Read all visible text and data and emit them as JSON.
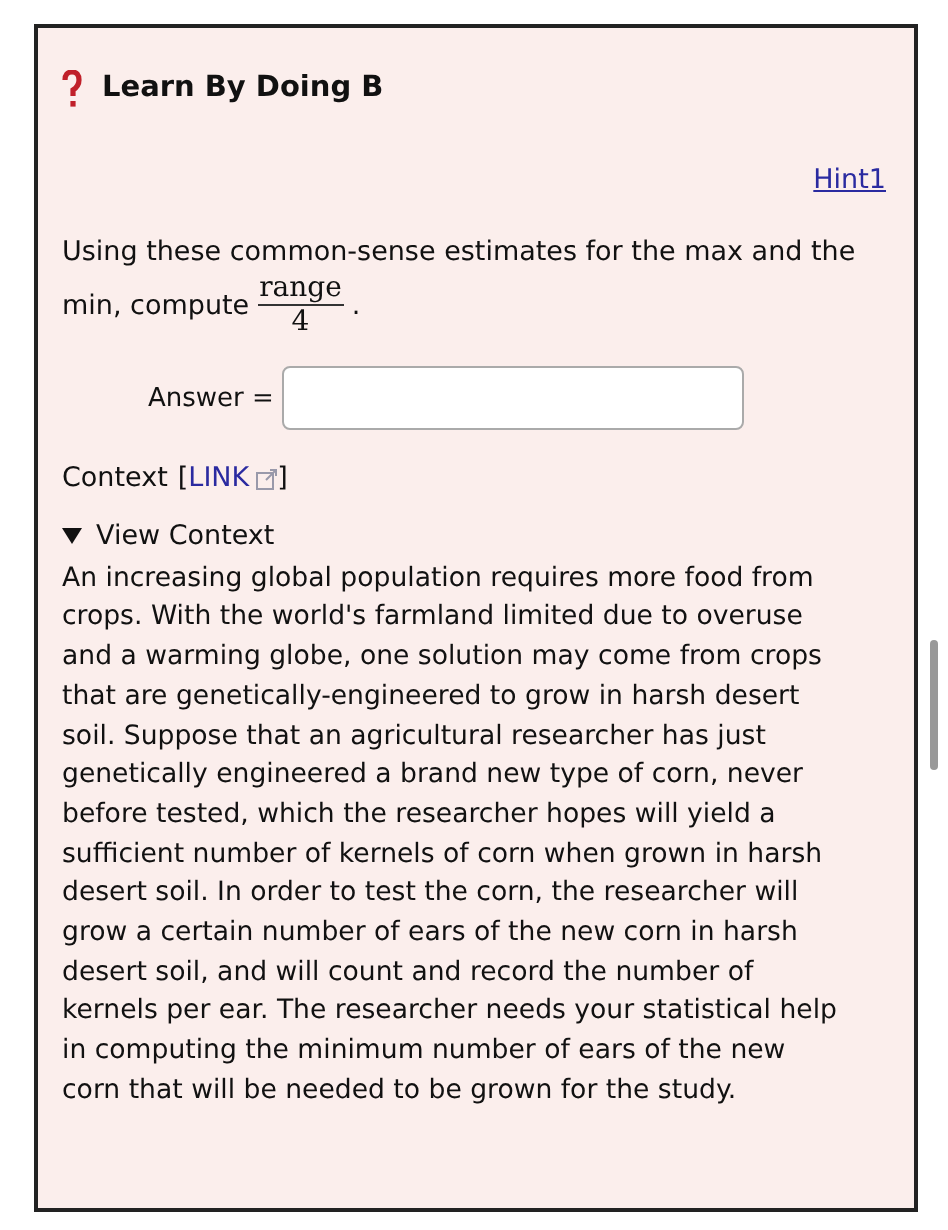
{
  "title": "Learn By Doing B",
  "hint_link": "Hint1",
  "question": {
    "line_1": "Using these common-sense estimates for the max and the",
    "before": "min, compute",
    "numerator": "range",
    "denominator": "4",
    "after": "."
  },
  "answer": {
    "label": "Answer ="
  },
  "context": {
    "label": "Context",
    "open_bracket": "[",
    "link": "LINK",
    "close_bracket": "]"
  },
  "view_context": {
    "label": "View Context",
    "expanded": true,
    "text": "An increasing global population requires more food from crops. With the world's farmland limited due to overuse and a warming globe, one solution may come from crops that are genetically-engineered to grow in harsh desert soil. Suppose that an agricultural researcher has just genetically engineered a brand new type of corn, never before tested, which the researcher hopes will yield a sufficient number of kernels of corn when grown in harsh desert soil. In order to test the corn, the researcher will grow a certain number of ears of the new corn in harsh desert soil, and will count and record the number of kernels per ear. The researcher needs your statistical help in computing the minimum number of ears of the new corn that will be needed to be grown for the study."
  }
}
